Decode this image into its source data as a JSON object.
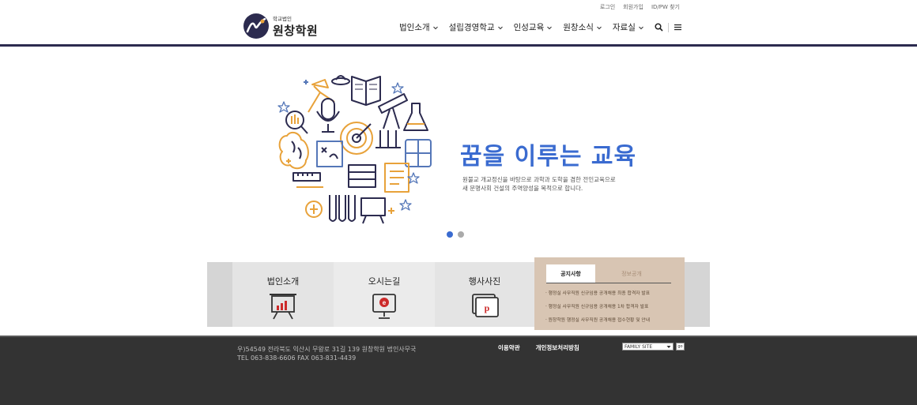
{
  "util": {
    "login": "로그인",
    "signup": "회원가입",
    "find": "ID/PW 찾기"
  },
  "logo": {
    "small": "학교법인",
    "big": "원창학원"
  },
  "nav": {
    "items": [
      {
        "label": "법인소개"
      },
      {
        "label": "설립경영학교"
      },
      {
        "label": "인성교육"
      },
      {
        "label": "원창소식"
      },
      {
        "label": "자료실"
      }
    ]
  },
  "hero": {
    "title": "꿈을 이루는 교육",
    "desc_line1": "원불교 개교정신을 바탕으로 과학과 도학을 겸한 전인교육으로",
    "desc_line2": "새 문명사회 건설의 주역양성을 목적으로 합니다."
  },
  "quick": {
    "cards": [
      {
        "label": "법인소개"
      },
      {
        "label": "오시는길"
      },
      {
        "label": "행사사진"
      }
    ]
  },
  "notice": {
    "tab_active": "공지사항",
    "tab_inactive": "정보공개",
    "items": [
      "· 행정실 사무직원 신규임용 공개채용 최종 합격자 발표",
      "· 행정실 사무직원 신규임용 공개채용 1차 합격자 발표",
      "· 원창학원 행정실 사무직원 공개채용 접수현황 및 안내"
    ]
  },
  "footer": {
    "address": "우)54549 전라북도 익산시 무왕로 31길 139 원창학원 법인사무국",
    "tel": "TEL 063-838-6606 FAX 063-831-4439",
    "terms": "이용약관",
    "privacy": "개인정보처리방침",
    "family_site": "FAMILY SITE",
    "go": "go"
  },
  "colors": {
    "accent": "#3a6bd0",
    "header_line": "#2c2b4f",
    "footer_bg": "#333333",
    "notice_bg": "#d8c5b3"
  }
}
